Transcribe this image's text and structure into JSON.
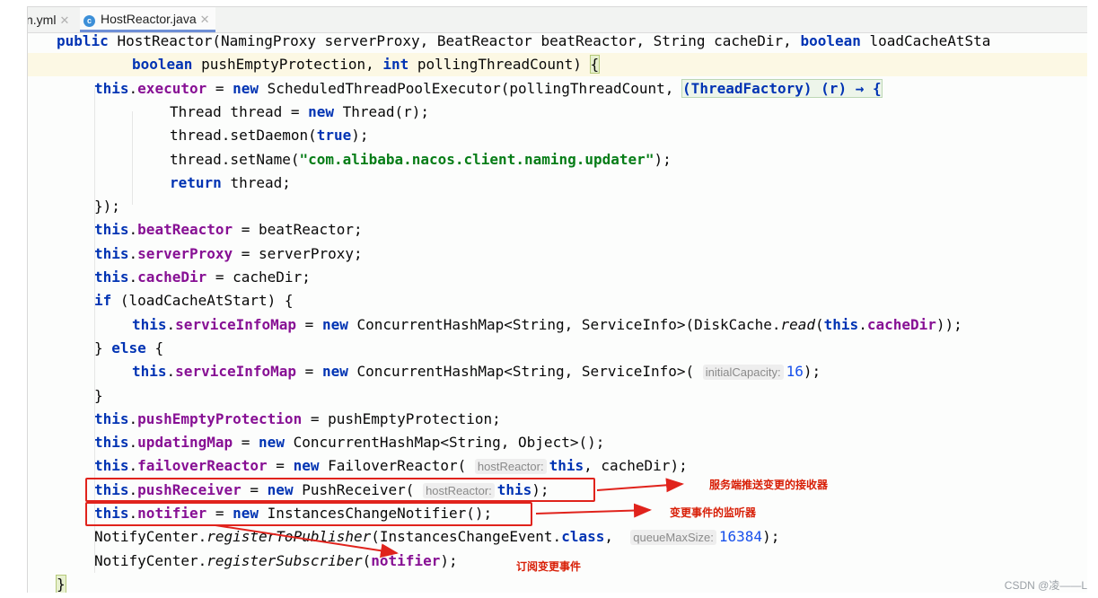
{
  "tabs": [
    {
      "label": "n.yml",
      "active": false,
      "icon": "yaml-file-icon"
    },
    {
      "label": "HostReactor.java",
      "active": true,
      "icon": "java-class-icon",
      "icon_glyph": "c"
    }
  ],
  "code": {
    "lines": [
      {
        "indent": 32,
        "cur": false,
        "tokens": [
          {
            "t": "public ",
            "c": "kw"
          },
          {
            "t": "HostReactor(NamingProxy serverProxy, BeatReactor beatReactor, String cacheDir, "
          },
          {
            "t": "boolean ",
            "c": "kw"
          },
          {
            "t": "loadCacheAtSta"
          }
        ]
      },
      {
        "indent": 116,
        "cur": true,
        "tokens": [
          {
            "t": "boolean ",
            "c": "kw"
          },
          {
            "t": "pushEmptyProtection, "
          },
          {
            "t": "int ",
            "c": "kw"
          },
          {
            "t": "pollingThreadCount) "
          },
          {
            "t": "{",
            "c": "brace"
          }
        ]
      },
      {
        "indent": 74,
        "cur": false,
        "tokens": [
          {
            "t": "this",
            "c": "kw"
          },
          {
            "t": "."
          },
          {
            "t": "executor",
            "c": "fld"
          },
          {
            "t": " = "
          },
          {
            "t": "new ",
            "c": "kw"
          },
          {
            "t": "ScheduledThreadPoolExecutor(pollingThreadCount, "
          },
          {
            "t": "(ThreadFactory) (r) → {",
            "c": "lambda"
          }
        ]
      },
      {
        "indent": 158,
        "cur": false,
        "tokens": [
          {
            "t": "Thread thread = "
          },
          {
            "t": "new ",
            "c": "kw"
          },
          {
            "t": "Thread(r);"
          }
        ]
      },
      {
        "indent": 158,
        "cur": false,
        "tokens": [
          {
            "t": "thread.setDaemon("
          },
          {
            "t": "true",
            "c": "kw"
          },
          {
            "t": ");"
          }
        ]
      },
      {
        "indent": 158,
        "cur": false,
        "tokens": [
          {
            "t": "thread.setName("
          },
          {
            "t": "\"com.alibaba.nacos.client.naming.updater\"",
            "c": "str"
          },
          {
            "t": ");"
          }
        ]
      },
      {
        "indent": 158,
        "cur": false,
        "tokens": [
          {
            "t": "return ",
            "c": "kw"
          },
          {
            "t": "thread;"
          }
        ]
      },
      {
        "indent": 74,
        "cur": false,
        "tokens": [
          {
            "t": "});"
          }
        ]
      },
      {
        "indent": 74,
        "cur": false,
        "tokens": [
          {
            "t": "this",
            "c": "kw"
          },
          {
            "t": "."
          },
          {
            "t": "beatReactor",
            "c": "fld"
          },
          {
            "t": " = beatReactor;"
          }
        ]
      },
      {
        "indent": 74,
        "cur": false,
        "tokens": [
          {
            "t": "this",
            "c": "kw"
          },
          {
            "t": "."
          },
          {
            "t": "serverProxy",
            "c": "fld"
          },
          {
            "t": " = serverProxy;"
          }
        ]
      },
      {
        "indent": 74,
        "cur": false,
        "tokens": [
          {
            "t": "this",
            "c": "kw"
          },
          {
            "t": "."
          },
          {
            "t": "cacheDir",
            "c": "fld"
          },
          {
            "t": " = cacheDir;"
          }
        ]
      },
      {
        "indent": 74,
        "cur": false,
        "tokens": [
          {
            "t": "if ",
            "c": "kw"
          },
          {
            "t": "(loadCacheAtStart) {"
          }
        ]
      },
      {
        "indent": 116,
        "cur": false,
        "tokens": [
          {
            "t": "this",
            "c": "kw"
          },
          {
            "t": "."
          },
          {
            "t": "serviceInfoMap",
            "c": "fld"
          },
          {
            "t": " = "
          },
          {
            "t": "new ",
            "c": "kw"
          },
          {
            "t": "ConcurrentHashMap<String, ServiceInfo>(DiskCache."
          },
          {
            "t": "read",
            "c": "it"
          },
          {
            "t": "("
          },
          {
            "t": "this",
            "c": "kw"
          },
          {
            "t": "."
          },
          {
            "t": "cacheDir",
            "c": "fld"
          },
          {
            "t": "));"
          }
        ]
      },
      {
        "indent": 74,
        "cur": false,
        "tokens": [
          {
            "t": "} "
          },
          {
            "t": "else ",
            "c": "kw"
          },
          {
            "t": "{"
          }
        ]
      },
      {
        "indent": 116,
        "cur": false,
        "tokens": [
          {
            "t": "this",
            "c": "kw"
          },
          {
            "t": "."
          },
          {
            "t": "serviceInfoMap",
            "c": "fld"
          },
          {
            "t": " = "
          },
          {
            "t": "new ",
            "c": "kw"
          },
          {
            "t": "ConcurrentHashMap<String, ServiceInfo>( "
          },
          {
            "t": "initialCapacity:",
            "c": "hint"
          },
          {
            "t": "16",
            "c": "num"
          },
          {
            "t": ");"
          }
        ]
      },
      {
        "indent": 74,
        "cur": false,
        "tokens": [
          {
            "t": "}"
          }
        ]
      },
      {
        "indent": 74,
        "cur": false,
        "tokens": [
          {
            "t": "this",
            "c": "kw"
          },
          {
            "t": "."
          },
          {
            "t": "pushEmptyProtection",
            "c": "fld"
          },
          {
            "t": " = pushEmptyProtection;"
          }
        ]
      },
      {
        "indent": 74,
        "cur": false,
        "tokens": [
          {
            "t": "this",
            "c": "kw"
          },
          {
            "t": "."
          },
          {
            "t": "updatingMap",
            "c": "fld"
          },
          {
            "t": " = "
          },
          {
            "t": "new ",
            "c": "kw"
          },
          {
            "t": "ConcurrentHashMap<String, Object>();"
          }
        ]
      },
      {
        "indent": 74,
        "cur": false,
        "tokens": [
          {
            "t": "this",
            "c": "kw"
          },
          {
            "t": "."
          },
          {
            "t": "failoverReactor",
            "c": "fld"
          },
          {
            "t": " = "
          },
          {
            "t": "new ",
            "c": "kw"
          },
          {
            "t": "FailoverReactor( "
          },
          {
            "t": "hostReactor:",
            "c": "hint"
          },
          {
            "t": "this",
            "c": "kw"
          },
          {
            "t": ", cacheDir);"
          }
        ]
      },
      {
        "indent": 74,
        "cur": false,
        "tokens": [
          {
            "t": "this",
            "c": "kw"
          },
          {
            "t": "."
          },
          {
            "t": "pushReceiver",
            "c": "fld"
          },
          {
            "t": " = "
          },
          {
            "t": "new ",
            "c": "kw"
          },
          {
            "t": "PushReceiver( "
          },
          {
            "t": "hostReactor:",
            "c": "hint"
          },
          {
            "t": "this",
            "c": "kw"
          },
          {
            "t": ");"
          }
        ]
      },
      {
        "indent": 74,
        "cur": false,
        "tokens": [
          {
            "t": "this",
            "c": "kw"
          },
          {
            "t": "."
          },
          {
            "t": "notifier",
            "c": "fld"
          },
          {
            "t": " = "
          },
          {
            "t": "new ",
            "c": "kw"
          },
          {
            "t": "InstancesChangeNotifier();"
          }
        ]
      },
      {
        "indent": 74,
        "cur": false,
        "tokens": [
          {
            "t": "NotifyCenter."
          },
          {
            "t": "registerToPublisher",
            "c": "it"
          },
          {
            "t": "(InstancesChangeEvent."
          },
          {
            "t": "class",
            "c": "kw"
          },
          {
            "t": ",  "
          },
          {
            "t": "queueMaxSize:",
            "c": "hint"
          },
          {
            "t": "16384",
            "c": "num"
          },
          {
            "t": ");"
          }
        ]
      },
      {
        "indent": 74,
        "cur": false,
        "tokens": [
          {
            "t": "NotifyCenter."
          },
          {
            "t": "registerSubscriber",
            "c": "it"
          },
          {
            "t": "("
          },
          {
            "t": "notifier",
            "c": "fld"
          },
          {
            "t": ");"
          }
        ]
      },
      {
        "indent": 32,
        "cur": false,
        "tokens": [
          {
            "t": "}",
            "c": "brace"
          }
        ]
      }
    ]
  },
  "annotations": {
    "push_receiver": "服务端推送变更的接收器",
    "notifier": "变更事件的监听器",
    "subscriber": "订阅变更事件"
  },
  "watermark": "CSDN @凌——L",
  "colors": {
    "annotation_red": "#e0231c",
    "keyword": "#0033b3",
    "field": "#871094",
    "string": "#067d17",
    "number": "#1750eb"
  }
}
